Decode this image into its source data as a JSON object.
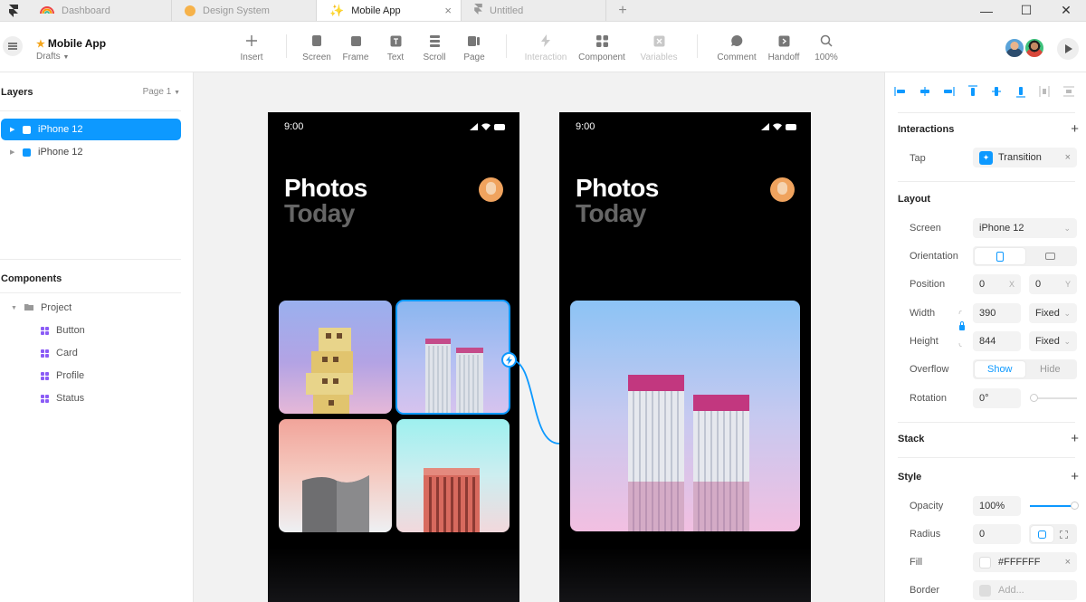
{
  "tabs": [
    {
      "label": "Dashboard",
      "icon": "rainbow-icon",
      "active": false
    },
    {
      "label": "Design System",
      "icon": "orange-dot-icon",
      "active": false
    },
    {
      "label": "Mobile App",
      "icon": "sparkle-icon",
      "active": true
    },
    {
      "label": "Untitled",
      "icon": "framer-icon",
      "active": false
    }
  ],
  "header": {
    "project_name": "Mobile App",
    "project_sub": "Drafts"
  },
  "tools": [
    {
      "label": "Insert",
      "icon": "plus-icon"
    },
    {
      "label": "Screen",
      "icon": "screen-icon"
    },
    {
      "label": "Frame",
      "icon": "frame-icon"
    },
    {
      "label": "Text",
      "icon": "text-icon"
    },
    {
      "label": "Scroll",
      "icon": "scroll-icon"
    },
    {
      "label": "Page",
      "icon": "page-icon"
    },
    {
      "label": "Interaction",
      "icon": "bolt-icon",
      "disabled": true
    },
    {
      "label": "Component",
      "icon": "component-icon"
    },
    {
      "label": "Variables",
      "icon": "variables-icon",
      "disabled": true
    },
    {
      "label": "Comment",
      "icon": "comment-icon"
    },
    {
      "label": "Handoff",
      "icon": "handoff-icon"
    },
    {
      "label": "100%",
      "icon": "search-icon"
    }
  ],
  "layers": {
    "title": "Layers",
    "page": "Page 1",
    "items": [
      "iPhone 12",
      "iPhone 12"
    ]
  },
  "components": {
    "title": "Components",
    "folder": "Project",
    "items": [
      "Button",
      "Card",
      "Profile",
      "Status"
    ]
  },
  "phones": [
    {
      "time": "9:00",
      "title": "Photos",
      "subtitle": "Today"
    },
    {
      "time": "9:00",
      "title": "Photos",
      "subtitle": "Today"
    }
  ],
  "right": {
    "interactions": {
      "title": "Interactions",
      "tap_label": "Tap",
      "tap_value": "Transition"
    },
    "layout": {
      "title": "Layout",
      "screen_label": "Screen",
      "screen_value": "iPhone 12",
      "orientation_label": "Orientation",
      "position_label": "Position",
      "pos_x": "0",
      "pos_x_suffix": "X",
      "pos_y": "0",
      "pos_y_suffix": "Y",
      "width_label": "Width",
      "width_value": "390",
      "width_mode": "Fixed",
      "height_label": "Height",
      "height_value": "844",
      "height_mode": "Fixed",
      "overflow_label": "Overflow",
      "overflow_show": "Show",
      "overflow_hide": "Hide",
      "rotation_label": "Rotation",
      "rotation_value": "0°"
    },
    "stack": {
      "title": "Stack"
    },
    "style": {
      "title": "Style",
      "opacity_label": "Opacity",
      "opacity_value": "100%",
      "radius_label": "Radius",
      "radius_value": "0",
      "fill_label": "Fill",
      "fill_value": "#FFFFFF",
      "border_label": "Border",
      "border_value": "Add..."
    }
  },
  "colors": {
    "accent": "#0d99ff"
  }
}
